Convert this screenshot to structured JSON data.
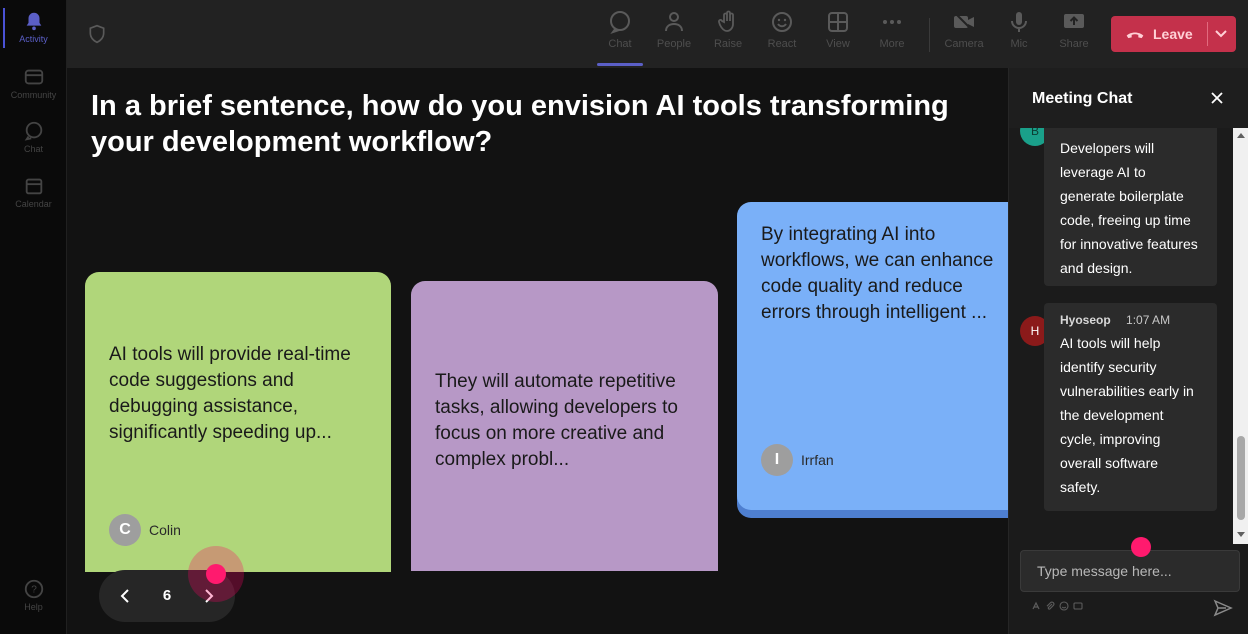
{
  "rail": {
    "items": [
      {
        "label": "Activity",
        "icon": "bell-icon"
      },
      {
        "label": "Community",
        "icon": "community-icon"
      },
      {
        "label": "Chat",
        "icon": "chat-icon"
      },
      {
        "label": "Calendar",
        "icon": "calendar-icon"
      },
      {
        "label": "Help",
        "icon": "help-icon"
      }
    ]
  },
  "toolbar": {
    "tools": [
      {
        "label": "Chat",
        "icon": "chat-bubble-icon"
      },
      {
        "label": "People",
        "icon": "people-icon"
      },
      {
        "label": "Raise",
        "icon": "raise-hand-icon"
      },
      {
        "label": "React",
        "icon": "smiley-icon"
      },
      {
        "label": "View",
        "icon": "grid-view-icon"
      },
      {
        "label": "More",
        "icon": "more-dots-icon"
      },
      {
        "label": "Camera",
        "icon": "camera-off-icon"
      },
      {
        "label": "Mic",
        "icon": "mic-icon"
      },
      {
        "label": "Share",
        "icon": "share-screen-icon"
      }
    ],
    "leave_label": "Leave",
    "leave_color": "#c4314b",
    "accent": "#5b5fc7"
  },
  "stage": {
    "question": "In a brief sentence, how do you envision AI tools transforming your development workflow?",
    "cards": [
      {
        "text": "AI tools will provide real-time code suggestions and debugging assistance, significantly speeding up...",
        "author": "Colin",
        "initial": "C",
        "color": "#b0d67a"
      },
      {
        "text": "They will automate repetitive tasks, allowing developers to focus on more creative and complex probl...",
        "color": "#b798c6"
      },
      {
        "text": "By integrating AI into workflows, we can enhance code quality and reduce errors through intelligent ...",
        "author": "Irrfan",
        "initial": "I",
        "color": "#7ab0f8"
      }
    ],
    "pager": {
      "page": "6"
    }
  },
  "chat": {
    "title": "Meeting Chat",
    "messages": [
      {
        "initial": "B",
        "text": "Developers will leverage AI to generate boilerplate code, freeing up time for innovative features and design."
      },
      {
        "initial": "H",
        "sender": "Hyoseop",
        "time": "1:07 AM",
        "text": "AI tools will help identify security vulnerabilities early in the development cycle, improving overall software safety."
      }
    ],
    "input_placeholder": "Type message here..."
  }
}
